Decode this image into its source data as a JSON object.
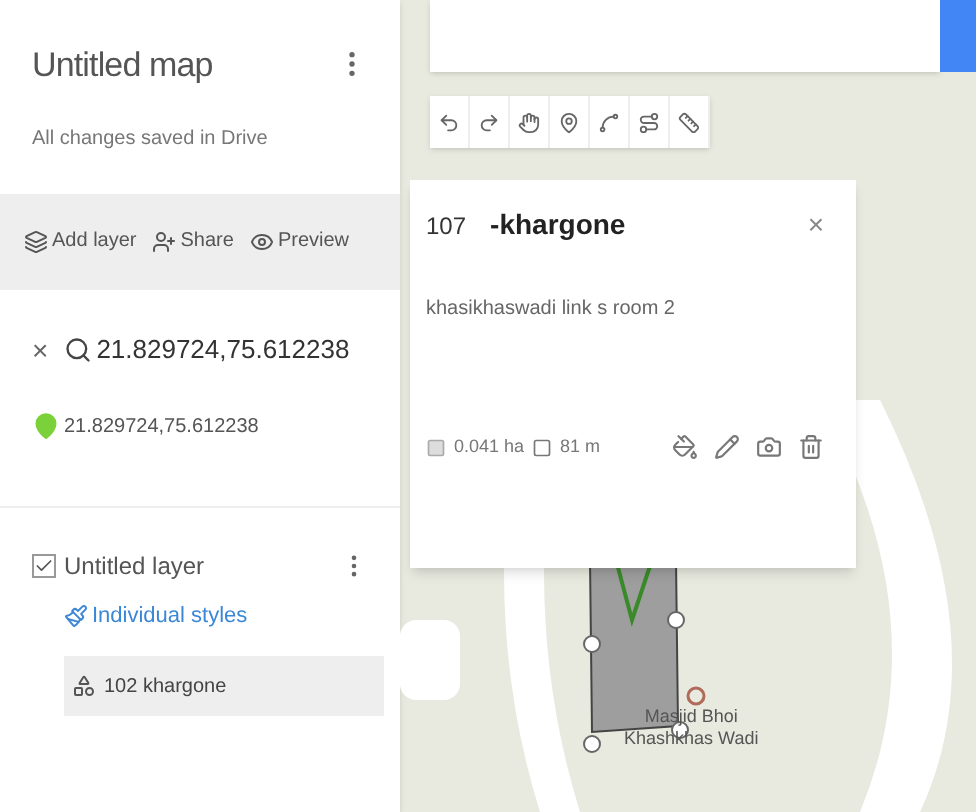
{
  "map_panel": {
    "title": "Untitled map",
    "status": "All changes saved in Drive",
    "actions": [
      {
        "kind": "add-layer",
        "label": "Add layer"
      },
      {
        "kind": "share",
        "label": "Share"
      },
      {
        "kind": "preview",
        "label": "Preview"
      }
    ]
  },
  "search": {
    "close": "×",
    "query": "21.829724,75.612238",
    "result": "21.829724,75.612238"
  },
  "layer": {
    "name": "Untitled layer",
    "checked": true,
    "style": "Individual styles",
    "features": [
      {
        "label": "102 khargone",
        "selected": true
      }
    ]
  },
  "toolbar": [
    {
      "kind": "undo"
    },
    {
      "kind": "redo"
    },
    {
      "kind": "hand"
    },
    {
      "kind": "marker"
    },
    {
      "kind": "line"
    },
    {
      "kind": "route"
    },
    {
      "kind": "ruler"
    }
  ],
  "popup": {
    "number": "107",
    "title": "-khargone",
    "close": "×",
    "description": "khasikhaswadi link s room 2",
    "area": "0.041 ha",
    "perimeter": "81 m"
  },
  "map_labels": [
    "Masjid Bhoi",
    "Khashkhas Wadi"
  ]
}
